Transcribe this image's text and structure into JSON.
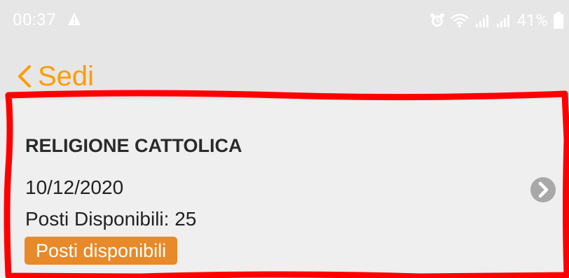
{
  "status_bar": {
    "time": "00:37",
    "battery_percent": "41%",
    "icons": [
      "warning-icon",
      "alarm-icon",
      "wifi-icon",
      "signal-icon",
      "signal-icon",
      "battery-icon"
    ]
  },
  "nav": {
    "back_label": "Sedi",
    "accent_color": "#ff9c00"
  },
  "card": {
    "title": "RELIGIONE CATTOLICA",
    "date": "10/12/2020",
    "posti_text": "Posti Disponibili: 25",
    "badge_label": "Posti disponibili",
    "badge_color": "#e8892a",
    "chevron_icon": "chevron-right-circle-icon"
  },
  "annotation": {
    "highlight_color": "#ff0000"
  }
}
